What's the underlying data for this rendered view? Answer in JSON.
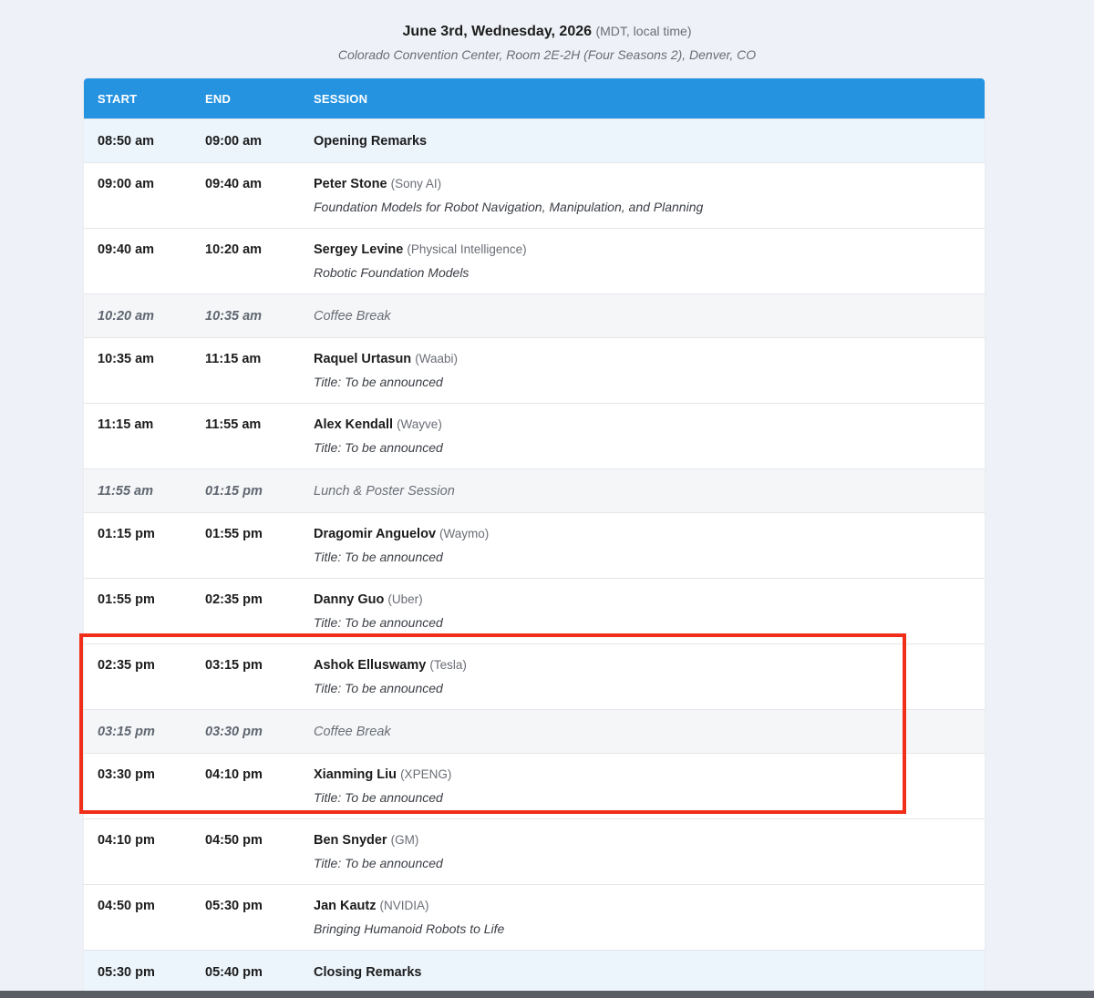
{
  "header": {
    "date": "June 3rd, Wednesday, 2026",
    "timezone": "(MDT, local time)",
    "venue": "Colorado Convention Center, Room 2E-2H (Four Seasons 2), Denver, CO"
  },
  "columns": {
    "start": "START",
    "end": "END",
    "session": "SESSION"
  },
  "rows": [
    {
      "type": "remark",
      "start": "08:50 am",
      "end": "09:00 am",
      "title": "Opening Remarks"
    },
    {
      "type": "talk",
      "start": "09:00 am",
      "end": "09:40 am",
      "speaker": "Peter Stone",
      "affiliation": "(Sony AI)",
      "talk": "Foundation Models for Robot Navigation, Manipulation, and Planning"
    },
    {
      "type": "talk",
      "start": "09:40 am",
      "end": "10:20 am",
      "speaker": "Sergey Levine",
      "affiliation": "(Physical Intelligence)",
      "talk": "Robotic Foundation Models"
    },
    {
      "type": "break",
      "start": "10:20 am",
      "end": "10:35 am",
      "title": "Coffee Break"
    },
    {
      "type": "talk",
      "start": "10:35 am",
      "end": "11:15 am",
      "speaker": "Raquel Urtasun",
      "affiliation": "(Waabi)",
      "talk": "Title: To be announced"
    },
    {
      "type": "talk",
      "start": "11:15 am",
      "end": "11:55 am",
      "speaker": "Alex Kendall",
      "affiliation": "(Wayve)",
      "talk": "Title: To be announced"
    },
    {
      "type": "break",
      "start": "11:55 am",
      "end": "01:15 pm",
      "title": "Lunch & Poster Session"
    },
    {
      "type": "talk",
      "start": "01:15 pm",
      "end": "01:55 pm",
      "speaker": "Dragomir Anguelov",
      "affiliation": "(Waymo)",
      "talk": "Title: To be announced"
    },
    {
      "type": "talk",
      "start": "01:55 pm",
      "end": "02:35 pm",
      "speaker": "Danny Guo",
      "affiliation": "(Uber)",
      "talk": "Title: To be announced"
    },
    {
      "type": "talk",
      "start": "02:35 pm",
      "end": "03:15 pm",
      "speaker": "Ashok Elluswamy",
      "affiliation": "(Tesla)",
      "talk": "Title: To be announced"
    },
    {
      "type": "break",
      "start": "03:15 pm",
      "end": "03:30 pm",
      "title": "Coffee Break"
    },
    {
      "type": "talk",
      "start": "03:30 pm",
      "end": "04:10 pm",
      "speaker": "Xianming Liu",
      "affiliation": "(XPENG)",
      "talk": "Title: To be announced"
    },
    {
      "type": "talk",
      "start": "04:10 pm",
      "end": "04:50 pm",
      "speaker": "Ben Snyder",
      "affiliation": "(GM)",
      "talk": "Title: To be announced"
    },
    {
      "type": "talk",
      "start": "04:50 pm",
      "end": "05:30 pm",
      "speaker": "Jan Kautz",
      "affiliation": "(NVIDIA)",
      "talk": "Bringing Humanoid Robots to Life"
    },
    {
      "type": "remark",
      "start": "05:30 pm",
      "end": "05:40 pm",
      "title": "Closing Remarks"
    }
  ],
  "colors": {
    "header_blue": "#2693e0",
    "highlight_red": "#f02e1a",
    "remark_bg": "#ecf4fc",
    "break_bg": "#f5f6f8",
    "page_bg": "#eef1f7"
  }
}
